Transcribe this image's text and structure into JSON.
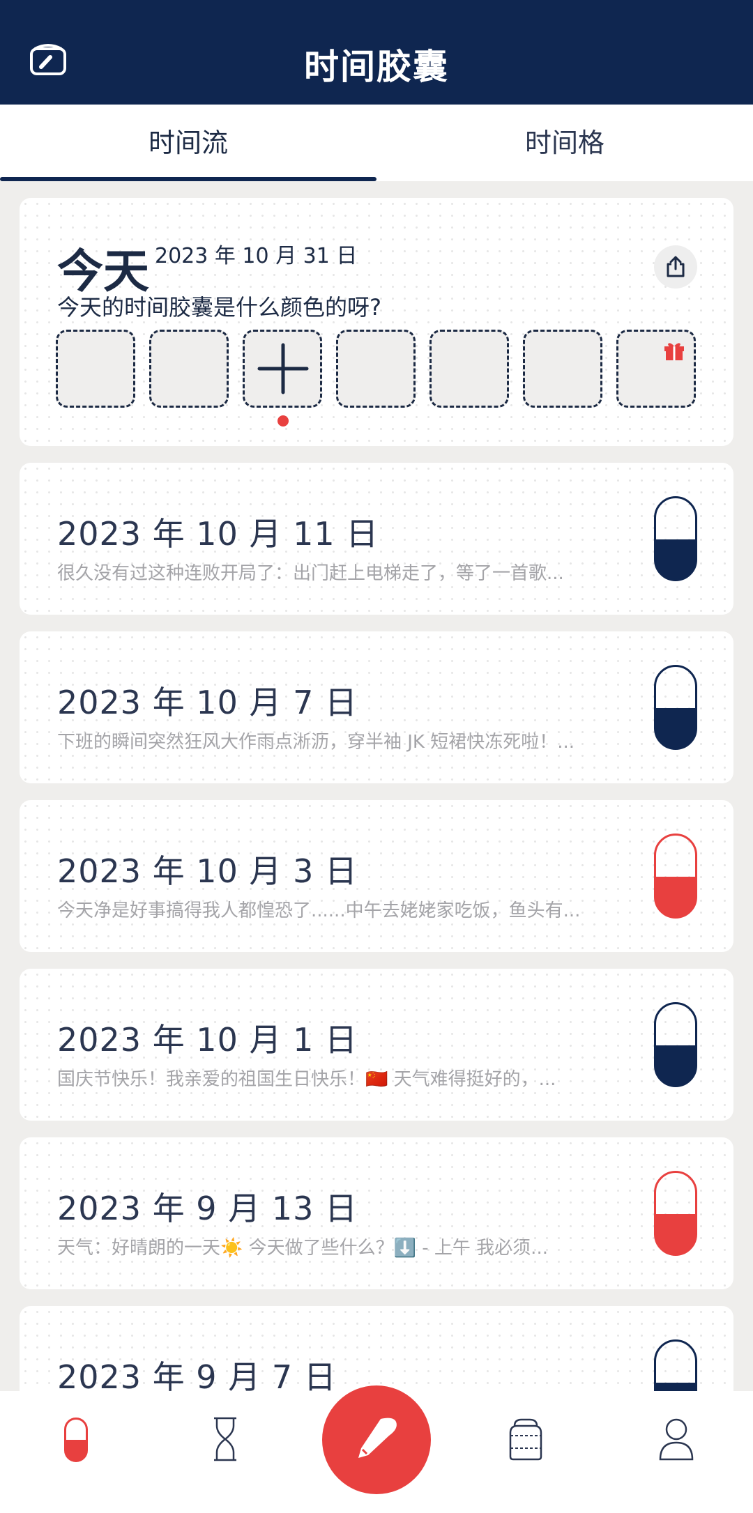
{
  "header": {
    "title": "时间胶囊",
    "left_icon": "capsule-box-icon"
  },
  "tabs": [
    {
      "label": "时间流",
      "active": true
    },
    {
      "label": "时间格",
      "active": false
    }
  ],
  "today": {
    "word": "今天",
    "date": "2023 年 10 月 31 日",
    "question": "今天的时间胶囊是什么颜色的呀?",
    "share_icon": "share-icon",
    "slot_icons": [
      "",
      "",
      "plus-icon",
      "",
      "",
      "",
      "gift-icon"
    ]
  },
  "entries": [
    {
      "date": "2023 年 10 月 11 日",
      "preview": "很久没有过这种连败开局了：出门赶上电梯走了，等了一首歌...",
      "capsule_color": "#0f2650"
    },
    {
      "date": "2023 年 10 月 7 日",
      "preview": "下班的瞬间突然狂风大作雨点淅沥，穿半袖 JK 短裙快冻死啦！...",
      "capsule_color": "#0f2650"
    },
    {
      "date": "2023 年 10 月 3 日",
      "preview": "今天净是好事搞得我人都惶恐了......中午去姥姥家吃饭，鱼头有...",
      "capsule_color": "#e8403f"
    },
    {
      "date": "2023 年 10 月 1 日",
      "preview": "国庆节快乐！我亲爱的祖国生日快乐！🇨🇳 天气难得挺好的，...",
      "capsule_color": "#0f2650"
    },
    {
      "date": "2023 年 9 月 13 日",
      "preview": "天气：好晴朗的一天☀️ 今天做了些什么？⬇️ - 上午 我必须...",
      "capsule_color": "#e8403f"
    },
    {
      "date": "2023 年 9 月 7 日",
      "preview": "",
      "capsule_color": "#0f2650"
    }
  ],
  "bottom_nav": [
    {
      "name": "capsule-tab",
      "icon": "capsule-icon"
    },
    {
      "name": "hourglass-tab",
      "icon": "hourglass-icon"
    },
    {
      "name": "write-button",
      "icon": "pen-icon"
    },
    {
      "name": "jar-tab",
      "icon": "jar-icon"
    },
    {
      "name": "profile-tab",
      "icon": "person-icon"
    }
  ],
  "colors": {
    "navy": "#0f2650",
    "red": "#e8403f",
    "background": "#efeeec"
  }
}
